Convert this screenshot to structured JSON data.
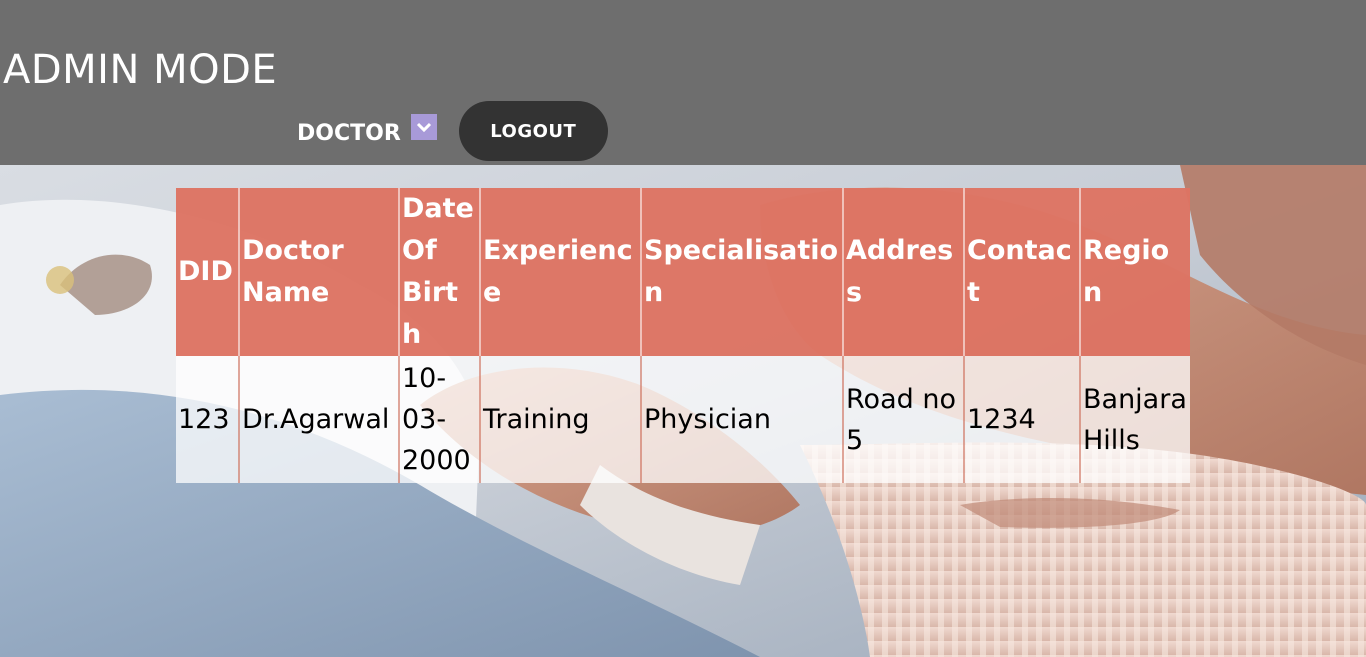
{
  "header": {
    "title": "ADMIN MODE",
    "select_value": "DOCTOR",
    "logout_label": "LOGOUT"
  },
  "table": {
    "columns": [
      "DID",
      "Doctor Name",
      "Date Of Birth",
      "Experience",
      "Specialisation",
      "Address",
      "Contact",
      "Region"
    ],
    "rows": [
      [
        "123",
        "Dr.Agarwal",
        "10-03-2000",
        "Training",
        "Physician",
        "Road no 5",
        "1234",
        "Banjara Hills"
      ]
    ]
  },
  "colors": {
    "header_bg": "#6e6e6e",
    "select_accent": "#a89ad8",
    "logout_bg": "#333333",
    "table_header_bg": "#dd7463"
  },
  "icons": {
    "select_arrow": "chevron-down-icon",
    "background": "hero-photo"
  }
}
